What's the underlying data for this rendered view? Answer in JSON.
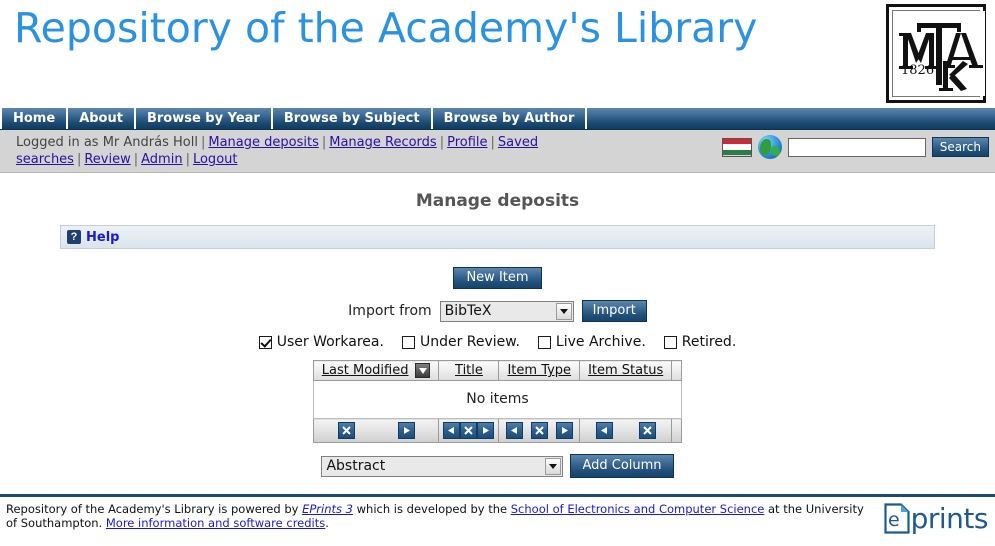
{
  "header": {
    "site_title": "Repository of the Academy's Library",
    "logo_alt": "MTAK",
    "logo_letters": [
      "M",
      "T",
      "A",
      "K"
    ],
    "logo_year": "1826"
  },
  "nav": {
    "items": [
      {
        "label": "Home",
        "name": "home"
      },
      {
        "label": "About",
        "name": "about"
      },
      {
        "label": "Browse by Year",
        "name": "browse-by-year"
      },
      {
        "label": "Browse by Subject",
        "name": "browse-by-subject"
      },
      {
        "label": "Browse by Author",
        "name": "browse-by-author"
      }
    ]
  },
  "userbar": {
    "logged_in_text": "Logged in as Mr András Holl",
    "links": [
      {
        "label": "Manage deposits",
        "name": "manage-deposits"
      },
      {
        "label": "Manage Records",
        "name": "manage-records"
      },
      {
        "label": "Profile",
        "name": "profile"
      },
      {
        "label": "Saved searches",
        "name": "saved-searches"
      },
      {
        "label": "Review",
        "name": "review"
      },
      {
        "label": "Admin",
        "name": "admin"
      },
      {
        "label": "Logout",
        "name": "logout"
      }
    ],
    "separator": "|",
    "flag_icon": "hungarian-flag-icon",
    "globe_icon": "globe-icon",
    "search_value": "",
    "search_placeholder": "",
    "search_button": "Search"
  },
  "main": {
    "page_title": "Manage deposits",
    "help": {
      "icon": "question-mark-icon",
      "label": "Help"
    },
    "new_item_button": "New Item",
    "import": {
      "label": "Import from",
      "selected": "BibTeX",
      "button": "Import"
    },
    "filters": [
      {
        "label": "User Workarea.",
        "checked": true,
        "name": "user-workarea"
      },
      {
        "label": "Under Review.",
        "checked": false,
        "name": "under-review"
      },
      {
        "label": "Live Archive.",
        "checked": false,
        "name": "live-archive"
      },
      {
        "label": "Retired.",
        "checked": false,
        "name": "retired"
      }
    ],
    "table": {
      "columns": [
        {
          "label": "Last Modified",
          "sorted": true,
          "sort_icon": "sort-descending-icon"
        },
        {
          "label": "Title",
          "sorted": false
        },
        {
          "label": "Item Type",
          "sorted": false
        },
        {
          "label": "Item Status",
          "sorted": false
        }
      ],
      "empty_message": "No items",
      "column_controls": [
        {
          "buttons": [
            "remove-column-icon",
            "move-right-icon"
          ]
        },
        {
          "buttons": [
            "move-left-icon",
            "remove-column-icon",
            "move-right-icon"
          ]
        },
        {
          "buttons": [
            "move-left-icon",
            "remove-column-icon",
            "move-right-icon"
          ]
        },
        {
          "buttons": [
            "move-left-icon",
            "remove-column-icon"
          ]
        }
      ]
    },
    "add_column": {
      "selected": "Abstract",
      "button": "Add Column"
    }
  },
  "footer": {
    "text_1": "Repository of the Academy's Library is powered by ",
    "link_eprints": "EPrints 3",
    "text_2": " which is developed by the ",
    "link_school": "School of Electronics and Computer Science",
    "text_3": " at the University of Southampton. ",
    "link_more": "More information and software credits",
    "text_4": ".",
    "logo_word": "prints",
    "logo_letter": "e"
  },
  "colors": {
    "title_blue": "#2a92e0",
    "nav_dark": "#14466e",
    "link_blue": "#2b0fa0",
    "accent": "#1b4a72"
  }
}
